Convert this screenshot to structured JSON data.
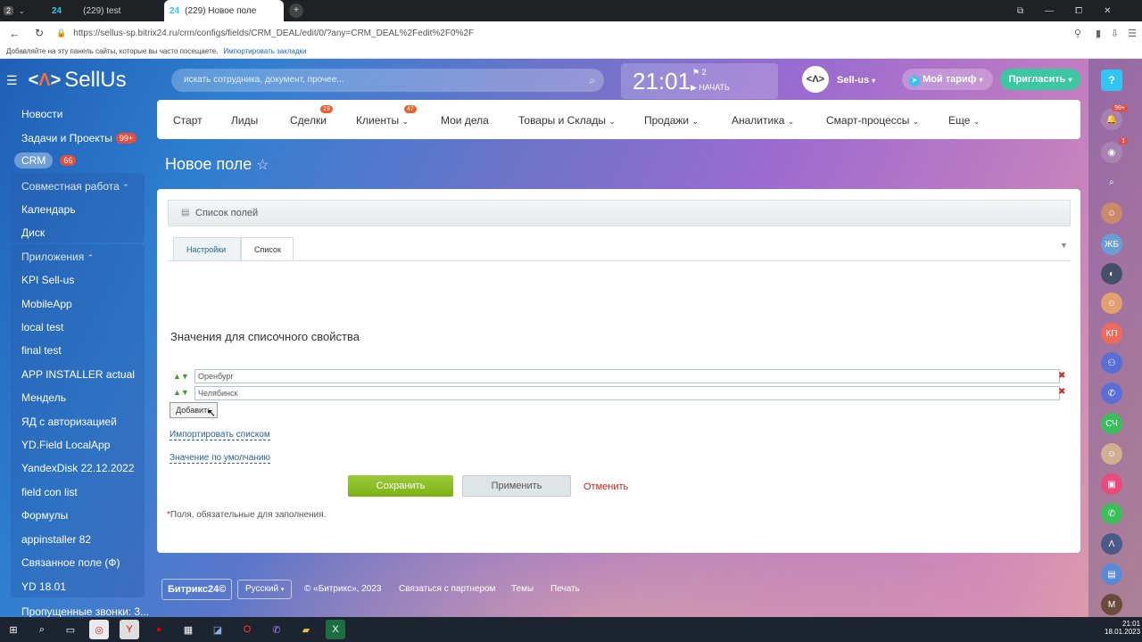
{
  "browser": {
    "tab_count": "2",
    "tabs": [
      {
        "label": "(229) test"
      },
      {
        "label": "(229) Новое поле"
      }
    ],
    "url": "https://sellus-sp.bitrix24.ru/crm/configs/fields/CRM_DEAL/edit/0/?any=CRM_DEAL%2Fedit%2F0%2F",
    "bookmarks_hint": "Добавляйте на эту панель сайты, которые вы часто посещаете.",
    "bookmarks_import": "Импортировать закладки"
  },
  "brand": {
    "logo_text": "SellUs"
  },
  "search": {
    "placeholder": "искать сотрудника, документ, прочее..."
  },
  "clock": {
    "time": "21:01",
    "flags": "2",
    "start": "НАЧАТЬ"
  },
  "user": {
    "name": "Sell-us"
  },
  "tariff": {
    "label": "Мой тариф"
  },
  "invite": {
    "label": "Пригласить"
  },
  "help": {
    "label": "?"
  },
  "sidebar": {
    "items": [
      {
        "label": "Новости"
      },
      {
        "label": "Задачи и Проекты",
        "badge": "99+"
      },
      {
        "label": "CRM",
        "badge": "66"
      },
      {
        "label": "Совместная работа"
      },
      {
        "label": "Календарь"
      },
      {
        "label": "Диск"
      },
      {
        "label": "Приложения"
      },
      {
        "label": "KPI Sell-us"
      },
      {
        "label": "MobileApp"
      },
      {
        "label": "local test"
      },
      {
        "label": "final test"
      },
      {
        "label": "APP INSTALLER actual"
      },
      {
        "label": "Мендель"
      },
      {
        "label": "ЯД с авторизацией"
      },
      {
        "label": "YD.Field LocalApp"
      },
      {
        "label": "YandexDisk 22.12.2022"
      },
      {
        "label": "field con list"
      },
      {
        "label": "Формулы"
      },
      {
        "label": "appinstaller 82"
      },
      {
        "label": "Связанное поле (Ф)"
      },
      {
        "label": "YD 18.01"
      },
      {
        "label": "Пропущенные звонки: 3..."
      }
    ]
  },
  "topnav": {
    "items": [
      {
        "label": "Старт"
      },
      {
        "label": "Лиды"
      },
      {
        "label": "Сделки",
        "badge": "19"
      },
      {
        "label": "Клиенты",
        "badge": "47"
      },
      {
        "label": "Мои дела"
      },
      {
        "label": "Товары и Склады"
      },
      {
        "label": "Продажи"
      },
      {
        "label": "Аналитика"
      },
      {
        "label": "Смарт-процессы"
      },
      {
        "label": "Еще"
      }
    ]
  },
  "page": {
    "title": "Новое поле"
  },
  "panel": {
    "title": "Список полей"
  },
  "tabs": [
    {
      "label": "Настройки"
    },
    {
      "label": "Список"
    }
  ],
  "list": {
    "title": "Значения для списочного свойства",
    "values": [
      "Оренбург",
      "Челябинск"
    ],
    "add": "Добавить",
    "import": "Импортировать списком",
    "default": "Значение по умолчанию"
  },
  "buttons": {
    "save": "Сохранить",
    "apply": "Применить",
    "cancel": "Отменить"
  },
  "required_note": "Поля, обязательные для заполнения.",
  "footer": {
    "brand": "Битрикс24©",
    "lang": "Русский",
    "copyright": "© «Битрикс», 2023",
    "partner": "Связаться с партнером",
    "themes": "Темы",
    "print": "Печать"
  },
  "rail": {
    "notif_badge": "99+",
    "chat_badge": "1",
    "avatars": [
      "ЖБ",
      "КП",
      "СЧ",
      "M"
    ]
  },
  "taskbar": {
    "time": "21:01",
    "date": "18.01.2023"
  }
}
